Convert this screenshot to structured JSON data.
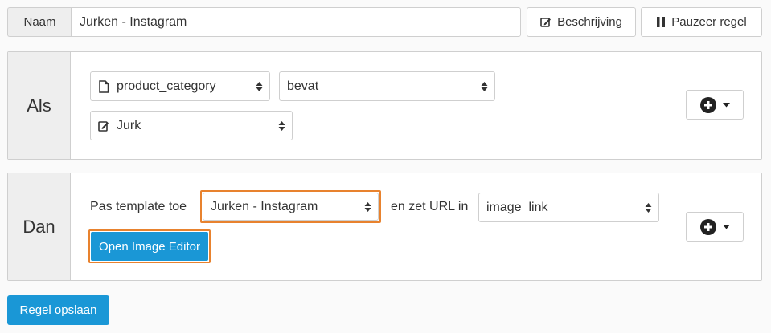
{
  "name_row": {
    "label": "Naam",
    "value": "Jurken - Instagram",
    "description_button": "Beschrijving",
    "description_icon": "edit-icon",
    "pause_button": "Pauzeer regel",
    "pause_icon": "pause-icon"
  },
  "condition": {
    "label": "Als",
    "field_select": {
      "value": "product_category",
      "icon": "file-icon"
    },
    "operator_select": {
      "value": "bevat"
    },
    "value_select": {
      "value": "Jurk",
      "icon": "edit-icon"
    },
    "add_button_icon": "plus-circle-icon"
  },
  "action": {
    "label": "Dan",
    "prefix_text": "Pas template toe",
    "template_select": {
      "value": "Jurken - Instagram"
    },
    "middle_text": "en zet URL in",
    "url_field_select": {
      "value": "image_link"
    },
    "editor_button": "Open Image Editor",
    "add_button_icon": "plus-circle-icon"
  },
  "footer": {
    "save_button": "Regel opslaan"
  },
  "colors": {
    "primary": "#1a97d6",
    "highlight": "#e8822e",
    "label_bg": "#eeeeee",
    "border": "#cfcfcf"
  }
}
